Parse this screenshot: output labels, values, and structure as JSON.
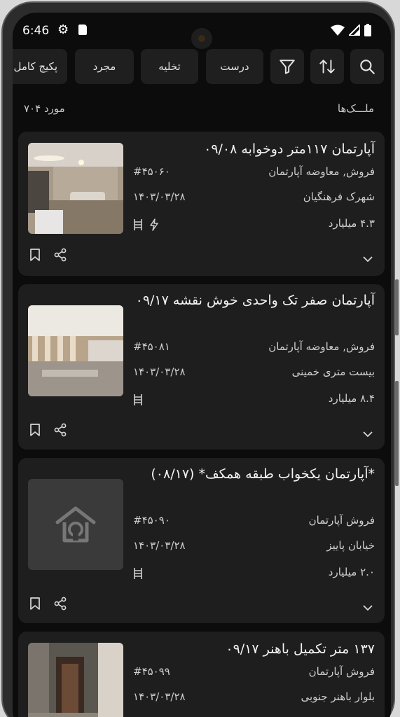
{
  "status_bar": {
    "time": "6:46"
  },
  "filters": {
    "search_icon": "search-icon",
    "sort_icon": "sort-icon",
    "filter_icon": "filter-icon",
    "chips": [
      "درست",
      "تخلیه",
      "مجرد",
      "پکیج کامل"
    ]
  },
  "list": {
    "title": "ملـــک‌ها",
    "count": "۷۰۴ مورد"
  },
  "cards": [
    {
      "title": "آپارتمان ۱۱۷متر دوخوابه ۰۹/۰۸",
      "code": "#۴۵۰۶۰",
      "deal": "فروش, معاوضه آپارتمان",
      "date": "۱۴۰۳/۰۳/۲۸",
      "location": "شهرک فرهنگیان",
      "price": "۴.۳ میلیارد"
    },
    {
      "title": "آپارتمان صفر تک واحدی خوش نقشه ۰۹/۱۷",
      "code": "#۴۵۰۸۱",
      "deal": "فروش, معاوضه آپارتمان",
      "date": "۱۴۰۳/۰۳/۲۸",
      "location": "بیست متری خمینی",
      "price": "۸.۴ میلیارد"
    },
    {
      "title": "*آپارتمان یکخواب طبقه همکف* (۰۸/۱۷)",
      "code": "#۴۵۰۹۰",
      "deal": "فروش آپارتمان",
      "date": "۱۴۰۳/۰۳/۲۸",
      "location": "خیابان پاییز",
      "price": "۲.۰ میلیارد"
    },
    {
      "title": "۱۳۷ متر تکمیل باهنر ۰۹/۱۷",
      "code": "#۴۵۰۹۹",
      "deal": "فروش آپارتمان",
      "date": "۱۴۰۳/۰۳/۲۸",
      "location": "بلوار باهنر جنوبی"
    }
  ]
}
